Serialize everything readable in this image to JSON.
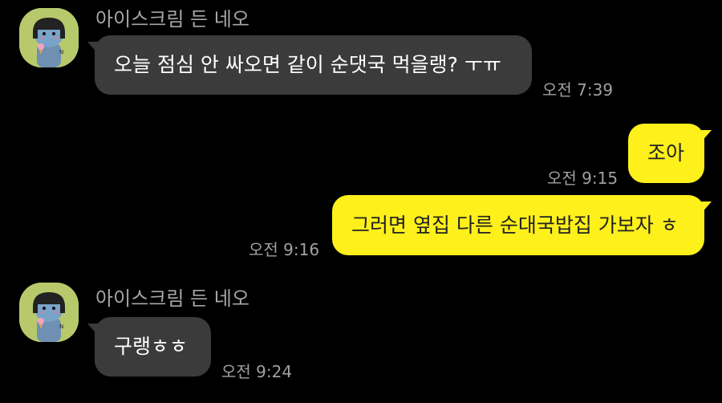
{
  "groups": [
    {
      "sender": "아이스크림 든 네오",
      "messages": [
        {
          "text": "오늘 점심 안 싸오면 같이 순댓국 먹을랭? ㅜㅠ",
          "time": "오전 7:39"
        }
      ]
    },
    {
      "sender": "me",
      "messages": [
        {
          "text": "조아",
          "time": "오전 9:15"
        },
        {
          "text": "그러면 옆집 다른 순대국밥집 가보자 ㅎ",
          "time": "오전 9:16"
        }
      ]
    },
    {
      "sender": "아이스크림 든 네오",
      "messages": [
        {
          "text": "구랭ㅎㅎ",
          "time": "오전 9:24"
        }
      ]
    }
  ],
  "colors": {
    "background": "#000000",
    "incoming_bubble": "#3b3b3b",
    "outgoing_bubble": "#fef01b",
    "avatar_bg": "#b7c96a"
  },
  "icons": {
    "avatar": "neo-cat-with-icecream-icon"
  }
}
